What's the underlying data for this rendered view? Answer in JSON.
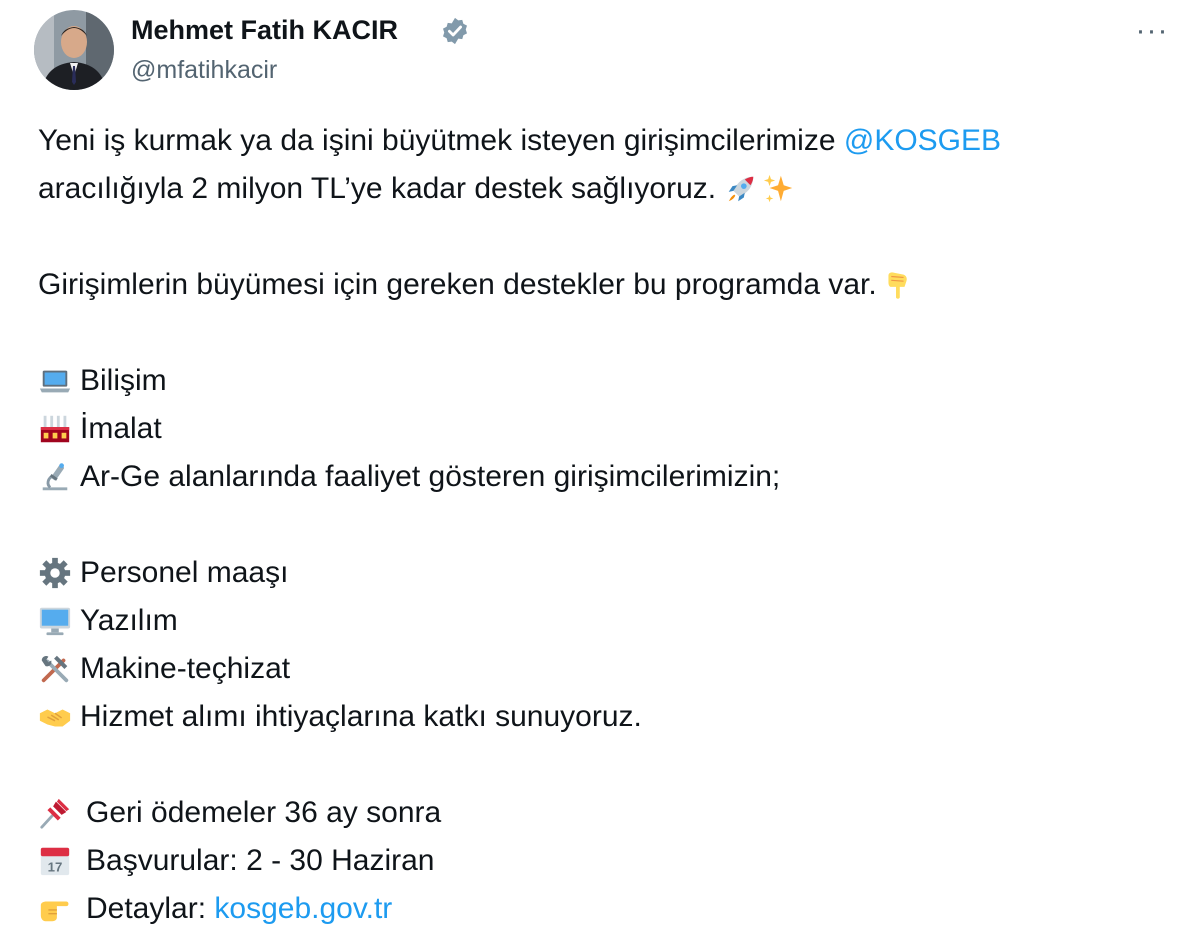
{
  "author": {
    "name": "Mehmet Fatih KACIR",
    "handle": "@mfatihkacir",
    "verified": true
  },
  "menu": {
    "more_label": "···"
  },
  "tweet": {
    "intro_part1": "Yeni iş kurmak ya da işini büyütmek isteyen girişimcilerimize",
    "mention": "@KOSGEB",
    "intro_part2": "aracılığıyla 2 milyon TL’ye kadar destek sağlıyoruz.",
    "supports_line": "Girişimlerin büyümesi için gereken destekler bu programda var.",
    "sectors": [
      {
        "icon": "laptop-icon",
        "label": "Bilişim"
      },
      {
        "icon": "factory-icon",
        "label": "İmalat"
      },
      {
        "icon": "microscope-icon",
        "label": "Ar-Ge alanlarında faaliyet gösteren girişimcilerimizin;"
      }
    ],
    "supports": [
      {
        "icon": "gear-icon",
        "label": "Personel maaşı"
      },
      {
        "icon": "desktop-icon",
        "label": "Yazılım"
      },
      {
        "icon": "tools-icon",
        "label": "Makine-teçhizat"
      },
      {
        "icon": "handshake-icon",
        "label": "Hizmet alımı ihtiyaçlarına katkı sunuyoruz."
      }
    ],
    "repayment": {
      "icon": "pushpin-icon",
      "label": "Geri ödemeler 36 ay sonra"
    },
    "application": {
      "icon": "calendar-icon",
      "label": "Başvurular: 2 - 30 Haziran",
      "calendar_day": "17"
    },
    "details": {
      "icon": "pointing-hand-icon",
      "label": "Detaylar:",
      "link": "kosgeb.gov.tr"
    }
  },
  "colors": {
    "text": "#0f1419",
    "secondary": "#536471",
    "link": "#1d9bf0",
    "verified": "#829aab"
  }
}
